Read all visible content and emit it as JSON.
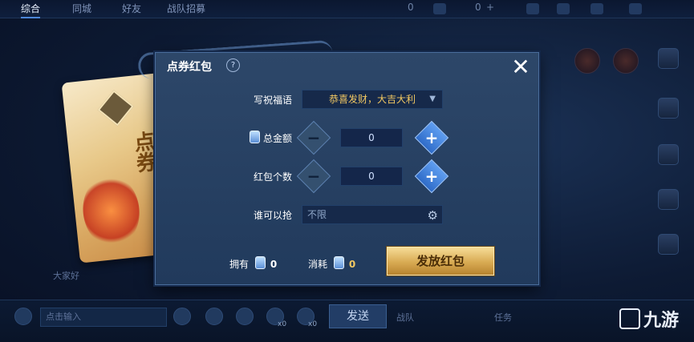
{
  "top_tabs": [
    "综合",
    "同城",
    "好友",
    "战队招募"
  ],
  "top_counts": [
    "0",
    "0"
  ],
  "top_badge_plus": "+",
  "dialog": {
    "title": "点券红包",
    "help": "?",
    "close": "✕",
    "blessing_label": "写祝福语",
    "blessing_value": "恭喜发财，大吉大利",
    "amount_label": "总金额",
    "amount_value": "0",
    "count_label": "红包个数",
    "count_value": "0",
    "who_label": "谁可以抢",
    "who_value": "不限",
    "own_label": "拥有",
    "own_value": "0",
    "cost_label": "消耗",
    "cost_value": "0",
    "send_button": "发放红包"
  },
  "packet": {
    "text": "点券"
  },
  "chat": {
    "left_hint": "大家好",
    "placeholder": "点击输入",
    "send": "发送",
    "x_counts": [
      "x0",
      "x0"
    ],
    "team_label": "战队",
    "task_label": "任务"
  },
  "watermark": "九游",
  "colors": {
    "accent": "#4c86d9",
    "gold": "#f2c862",
    "dialog_bg": "#2d4769"
  },
  "icons": [
    "help-icon",
    "close-icon",
    "dropdown-chevron-icon",
    "coupon-icon",
    "minus-icon",
    "plus-icon",
    "gear-icon",
    "mic-icon",
    "emoji-icon",
    "voice-icon"
  ]
}
